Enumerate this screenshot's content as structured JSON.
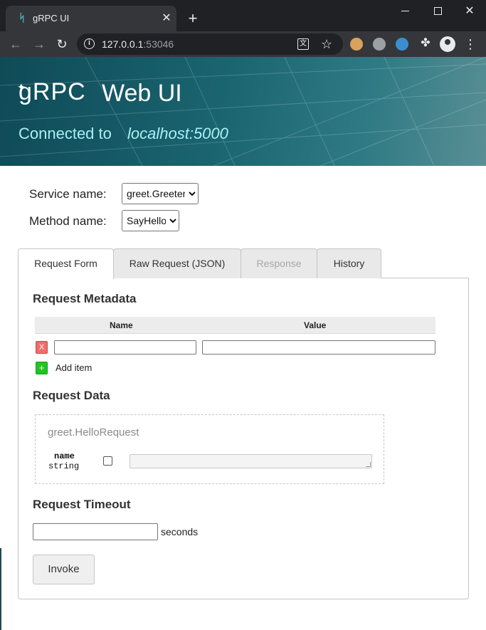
{
  "browser": {
    "tab_title": "gRPC UI",
    "favicon": "grpc-favicon",
    "close_tab": "✕",
    "new_tab": "+",
    "url_host": "127.0.0.1",
    "url_port": ":53046",
    "nav_back": "←",
    "nav_forward": "→",
    "reload": "↻"
  },
  "header": {
    "logo_text": "gRPC",
    "title": "Web UI",
    "connected_label": "Connected to",
    "host": "localhost:5000"
  },
  "selectors": {
    "service_label": "Service name:",
    "service_value": "greet.Greeter",
    "method_label": "Method name:",
    "method_value": "SayHello"
  },
  "tabs": [
    {
      "label": "Request Form",
      "state": "active"
    },
    {
      "label": "Raw Request (JSON)",
      "state": "normal"
    },
    {
      "label": "Response",
      "state": "disabled"
    },
    {
      "label": "History",
      "state": "normal"
    }
  ],
  "metadata": {
    "title": "Request Metadata",
    "col_name": "Name",
    "col_value": "Value",
    "remove_label": "X",
    "add_symbol": "+",
    "add_label": "Add item"
  },
  "request_data": {
    "title": "Request Data",
    "message_type": "greet.HelloRequest",
    "field_name": "name",
    "field_type": "string"
  },
  "timeout": {
    "title": "Request Timeout",
    "unit": "seconds"
  },
  "invoke_label": "Invoke",
  "colors": {
    "banner_start": "#0f4a57",
    "banner_end": "#5a8f95",
    "host_text": "#a9f0f4",
    "remove_button": "#f26b6b",
    "add_button": "#22c322"
  }
}
